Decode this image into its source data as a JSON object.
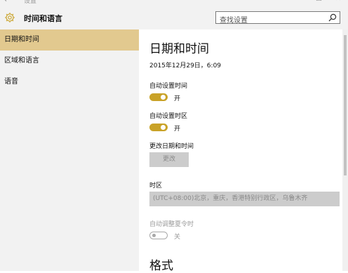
{
  "window": {
    "back_glyph": "←",
    "title": "设置",
    "controls": [
      "—",
      "☐",
      "✕"
    ]
  },
  "header": {
    "title": "时间和语言",
    "icon": "gear-icon",
    "search_placeholder": "查找设置"
  },
  "sidebar": {
    "items": [
      {
        "label": "日期和时间",
        "active": true
      },
      {
        "label": "区域和语言",
        "active": false
      },
      {
        "label": "语音",
        "active": false
      }
    ]
  },
  "main": {
    "title": "日期和时间",
    "datetime": "2015年12月29日，6:09",
    "auto_time": {
      "label": "自动设置时间",
      "state": "开",
      "on": true
    },
    "auto_timezone": {
      "label": "自动设置时区",
      "state": "开",
      "on": true
    },
    "change": {
      "label": "更改日期和时间",
      "button": "更改"
    },
    "timezone": {
      "label": "时区",
      "value": "(UTC+08:00)北京，重庆，香港特别行政区，乌鲁木齐"
    },
    "dst": {
      "label": "自动调整夏令时",
      "state": "关",
      "on": false
    },
    "format_title": "格式"
  },
  "colors": {
    "accent": "#c9a227",
    "selected_nav": "#e2c98f",
    "sidebar_bg": "#f2f2f2"
  }
}
